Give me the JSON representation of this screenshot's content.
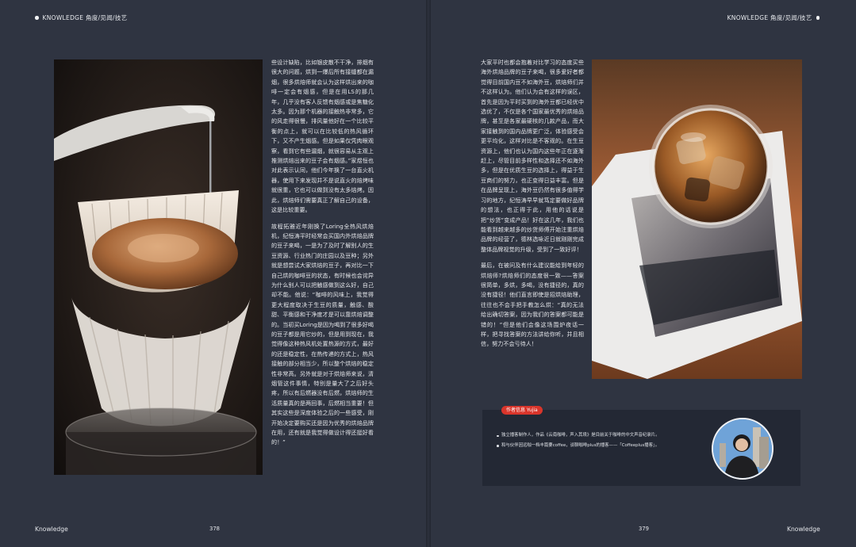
{
  "header": {
    "left": "KNOWLEDGE 角度/见闻/技艺",
    "right": "KNOWLEDGE 角度/见闻/技艺"
  },
  "article": {
    "col_a": [
      "些设计缺陷，比如银皮散不干净，排烟有很大的问题，烘到一爆后所有接缝都在漏烟，很多烘焙师就会认为这样烘出来的咖啡一定会有烟感，但是在用LS的那几年，几乎没有客人反馈有烟感或是焦糖化太多。因为那个机器的接触热非常多，它的风走得很慢，排风量他好在一个比较平衡的点上，就可以在比较低的热风循环下，又不产生烟感。但是如果仅凭肉眼观察，看到它有些漏烟，就很容易从主观上推测烘焙出来的豆子会有烟感。”家煜恒也对此表示认同，他们今年换了一台直火机器，使用下来发现并不是说直火的焙烤味就很重，它也可以做到没有太多焙烤。因此，烘焙师们需要真正了解自己的设备，这是比较重要。",
      "故程拓雅近年刚换了Loring全热风烘焙机，纪恒涛平时经常会买国内外烘焙品牌的豆子来喝，一是为了及时了解别人的生豆资源、行业热门的庄园以及豆种；另外就是想尝试大家烘焙的豆子，再对比一下自己烘的咖啡豆的状态，有时候也会诧异为什么别人可以把触感做到这么好，自己却不能。他说：“咖啡的风味上，我觉得更大程度取决于生豆的质量，触感、酸甜、平衡感和干净度才是可以靠烘焙调整的。当初买Loring是因为喝到了很多好喝的豆子都是用它炒的，但是用到现在，我觉得像这种热风机处置热源的方式，最好的还是稳定性，在热传递的方式上，热风接触的部分相当少，所以整个烘焙的稳定性非常高。另外就是对于烘焙师来说，清烟管这件事情，特别是量大了之后好头疼，所以有后燃器没有后燃，烘焙师的生活质量真的是两回事，后燃相当重要！但其实这些是深度体验之后的一些感受，刚开始决定要购买还是因为优秀的烘焙品牌在用，还有就是我觉得做设计得还挺好看的！”"
    ],
    "col_b": [
      "大家平时也都会抱着对比学习的态度买些海外烘焙品牌的豆子来喝，很多爱好者都觉得目前国内豆不如海外豆，烘焙师们并不这样认为。他们认为会有这样的误区，首先是因为平时买到的海外豆都已经优中选优了，不仅是各个国家最优秀的烘焙品牌，甚至是各家最硬核的几款产品，而大家接触到的国内品牌更广泛，体验感受会更平均化，这样对比是不客观的。在生豆资源上，他们也认为国内这些年正在逐渐赶上，尽管目前多样性和选择还不如海外多，但是在优质生豆的选择上，得益于生豆商们的努力，也正变得日益丰富。但是在品牌呈现上，海外豆仍然有很多值得学习的地方，纪恒涛早早就笃定要做好品牌的想法，也正得于此，用他的话说是把“炒货”变成产品！好在这几年，我们也能看到越来越多的炒货师傅开始注重烘焙品牌的经营了，德林选咏近日就刚刚完成整体品牌视觉的升级，受到了一致好评！",
      "最后，在被问及有什么建议能给到年轻的烘焙师?烘焙师们的态度很一致——答案很简单，多烘，多喝，没有捷径的，真的没有捷径！他们直言即使是招烘焙助理，往往也不会手把手教怎么烘：“真的无法给出确切答案，因为我们的答案都可能是错的！”但是他们会像这场围炉夜话一样，把寻找答案的方法讲给你听，并且相信，努力不会亏待人！"
    ]
  },
  "author": {
    "tag": "作者信息 Yujia",
    "items": [
      "独立播客制作人，作品《云南咖啡，声入其境》是目前关于咖啡的中文声音纪录片。",
      "和与伙伴因远咖一档丰篇要coffee，谈聊咖啡plus的播客——「Coffeeplus播客」。"
    ]
  },
  "footer": {
    "left": "Knowledge",
    "page_left": "378",
    "page_right": "379",
    "right": "Knowledge"
  },
  "colors": {
    "background": "#2f3441",
    "author_box": "#232834",
    "accent_red": "#d9352b"
  }
}
